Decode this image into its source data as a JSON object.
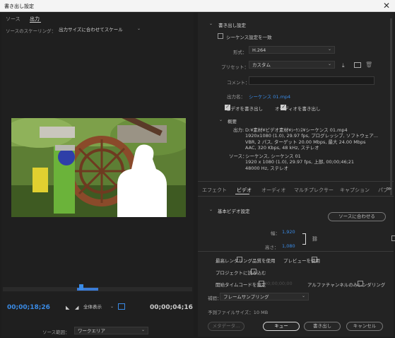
{
  "window": {
    "title": "書き出し設定",
    "close": "✕"
  },
  "left": {
    "tabs": [
      {
        "label": "ソース"
      },
      {
        "label": "出力"
      }
    ],
    "scaling_label": "ソースのスケーリング：",
    "scaling_value": "出力サイズに合わせてスケール",
    "timecode_current": "00;00;18;26",
    "fit_value": "全体表示",
    "timecode_duration": "00;00;04;16",
    "source_range_label": "ソース範囲：",
    "source_range_value": "ワークエリア"
  },
  "export_settings": {
    "section": "書き出し設定",
    "match_sequence": "シーケンス設定を一致",
    "format_label": "形式：",
    "format_value": "H.264",
    "preset_label": "プリセット：",
    "preset_value": "カスタム",
    "comment_label": "コメント：",
    "output_name_label": "出力名：",
    "output_name_value": "シーケンス 01.mp4",
    "export_video": "ビデオを書き出し",
    "export_audio": "オーディオを書き出し"
  },
  "summary": {
    "title": "概要",
    "output_label": "出力:",
    "output_lines": [
      "D:¥素材¥ビデオ素材¥ｼｰｹﾝｽ¥シーケンス 01.mp4",
      "1920x1080 (1.0), 29.97 fps, プログレッシブ, ソフトウェア...",
      "VBR, 2 パス, ターゲット 20.00 Mbps, 最大 24.00 Mbps",
      "AAC, 320 Kbps, 48 kHz, ステレオ"
    ],
    "source_label": "ソース：",
    "source_lines": [
      "シーケンス, シーケンス 01",
      "1920 x 1080 (1.0), 29.97 fps, 上部, 00;00;46;21",
      "48000 Hz, ステレオ"
    ]
  },
  "settings_tabs": [
    {
      "label": "エフェクト"
    },
    {
      "label": "ビデオ"
    },
    {
      "label": "オーディオ"
    },
    {
      "label": "マルチプレクサー"
    },
    {
      "label": "キャプション"
    },
    {
      "label": "パブ"
    }
  ],
  "video": {
    "section": "基本ビデオ設定",
    "match_source": "ソースに合わせる",
    "width_label": "幅：",
    "width_value": "1,920",
    "height_label": "高さ：",
    "height_value": "1,080"
  },
  "bottom": {
    "max_render": "最高レンダリング品質を使用",
    "use_preview": "プレビューを使用",
    "import_project": "プロジェクトに読み込む",
    "set_start_tc": "開始タイムコードを設定",
    "start_tc_value": "00;00;00;00",
    "alpha_only": "アルファチャンネルのみレンダリング",
    "interp_label": "補間：",
    "interp_value": "フレームサンプリング",
    "file_size": "予測ファイルサイズ：10 MB",
    "metadata": "メタデータ...",
    "queue": "キュー",
    "export": "書き出し",
    "cancel": "キャンセル"
  }
}
